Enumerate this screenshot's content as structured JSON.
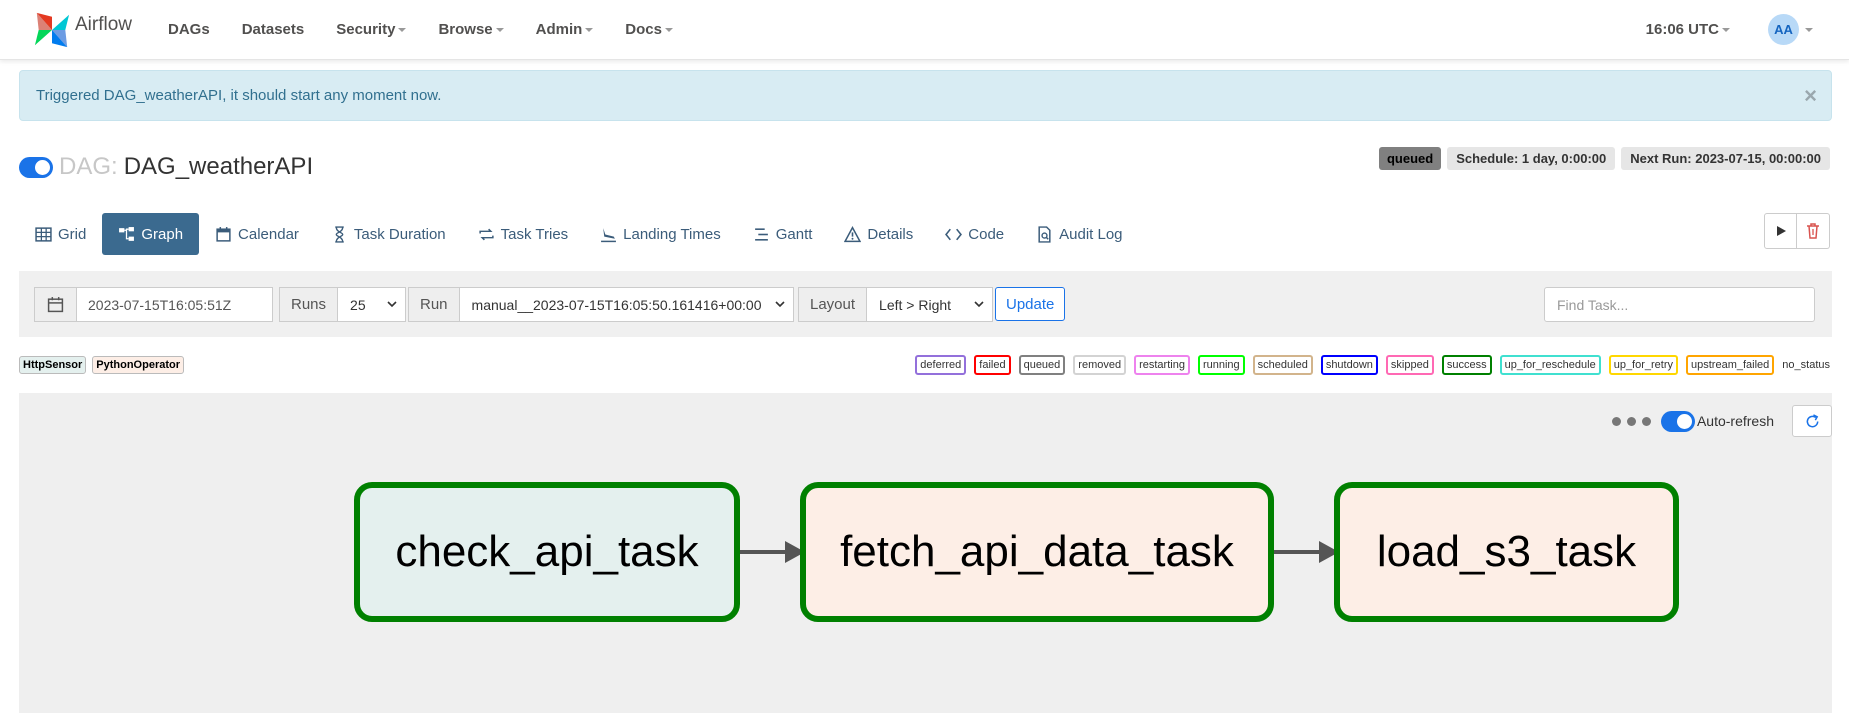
{
  "navbar": {
    "brand": "Airflow",
    "items": [
      {
        "label": "DAGs",
        "dropdown": false
      },
      {
        "label": "Datasets",
        "dropdown": false
      },
      {
        "label": "Security",
        "dropdown": true
      },
      {
        "label": "Browse",
        "dropdown": true
      },
      {
        "label": "Admin",
        "dropdown": true
      },
      {
        "label": "Docs",
        "dropdown": true
      }
    ],
    "clock": "16:06 UTC",
    "user_initials": "AA"
  },
  "alert": {
    "message": "Triggered DAG_weatherAPI, it should start any moment now.",
    "close": "×"
  },
  "dag": {
    "prefix": "DAG:",
    "name": "DAG_weatherAPI",
    "paused": false,
    "state": "queued",
    "schedule": "Schedule: 1 day, 0:00:00",
    "next_run": "Next Run: 2023-07-15, 00:00:00"
  },
  "tabs": [
    {
      "label": "Grid",
      "icon": "grid-icon",
      "active": false
    },
    {
      "label": "Graph",
      "icon": "graph-icon",
      "active": true
    },
    {
      "label": "Calendar",
      "icon": "calendar-icon",
      "active": false
    },
    {
      "label": "Task Duration",
      "icon": "hourglass-icon",
      "active": false
    },
    {
      "label": "Task Tries",
      "icon": "repeat-icon",
      "active": false
    },
    {
      "label": "Landing Times",
      "icon": "plane-landing-icon",
      "active": false
    },
    {
      "label": "Gantt",
      "icon": "gantt-icon",
      "active": false
    },
    {
      "label": "Details",
      "icon": "warning-triangle-icon",
      "active": false
    },
    {
      "label": "Code",
      "icon": "code-icon",
      "active": false
    },
    {
      "label": "Audit Log",
      "icon": "file-search-icon",
      "active": false
    }
  ],
  "controls": {
    "base_date": "2023-07-15T16:05:51Z",
    "runs_label": "Runs",
    "runs_value": "25",
    "run_label": "Run",
    "run_value": "manual__2023-07-15T16:05:50.161416+00:00",
    "layout_label": "Layout",
    "layout_value": "Left > Right",
    "update_label": "Update",
    "find_placeholder": "Find Task..."
  },
  "operators": [
    {
      "label": "HttpSensor",
      "color": "#e4f0ee"
    },
    {
      "label": "PythonOperator",
      "color": "#fdeee6"
    }
  ],
  "states": [
    {
      "label": "deferred",
      "color": "#9370db"
    },
    {
      "label": "failed",
      "color": "#ff0000"
    },
    {
      "label": "queued",
      "color": "#808080"
    },
    {
      "label": "removed",
      "color": "#d3d3d3"
    },
    {
      "label": "restarting",
      "color": "#ee82ee"
    },
    {
      "label": "running",
      "color": "#00ff00"
    },
    {
      "label": "scheduled",
      "color": "#d2b48c"
    },
    {
      "label": "shutdown",
      "color": "#0000ff"
    },
    {
      "label": "skipped",
      "color": "#ff69b4"
    },
    {
      "label": "success",
      "color": "#008000"
    },
    {
      "label": "up_for_reschedule",
      "color": "#40e0d0"
    },
    {
      "label": "up_for_retry",
      "color": "#ffd700"
    },
    {
      "label": "upstream_failed",
      "color": "#ffa500"
    }
  ],
  "no_status_label": "no_status",
  "graph": {
    "autorefresh_label": "Auto-refresh",
    "nodes": [
      {
        "label": "check_api_task",
        "operator": "HttpSensor",
        "state": "success"
      },
      {
        "label": "fetch_api_data_task",
        "operator": "PythonOperator",
        "state": "success"
      },
      {
        "label": "load_s3_task",
        "operator": "PythonOperator",
        "state": "success"
      }
    ]
  }
}
